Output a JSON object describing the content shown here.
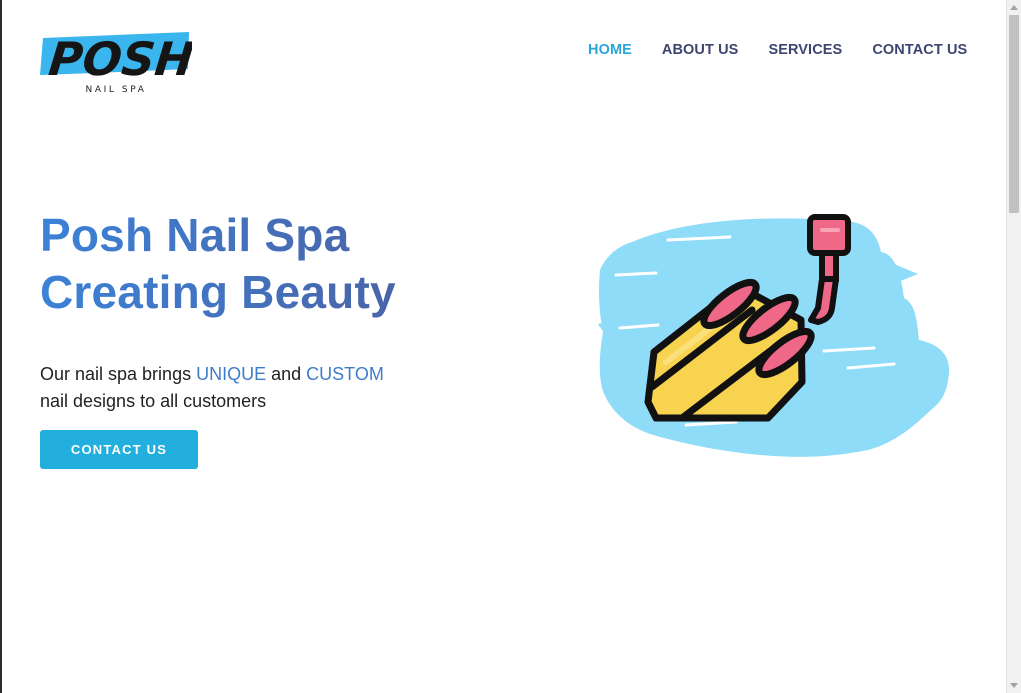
{
  "brand": {
    "logo_word": "POSH",
    "logo_tagline": "NAIL SPA",
    "accent_blue": "#26a6db",
    "logo_swatch": "#3bb5ee"
  },
  "nav": {
    "items": [
      {
        "label": "HOME",
        "active": true
      },
      {
        "label": "ABOUT US",
        "active": false
      },
      {
        "label": "SERVICES",
        "active": false
      },
      {
        "label": "CONTACT US",
        "active": false
      }
    ]
  },
  "hero": {
    "title_line1": "Posh Nail Spa",
    "title_line2": "Creating Beauty",
    "text_part1": "Our nail spa brings ",
    "highlight1": "UNIQUE",
    "text_part2": " and ",
    "highlight2": "CUSTOM",
    "text_part3": "nail designs to all customers",
    "cta_label": "CONTACT US",
    "illustration_icon": "nail-polish-hand-icon"
  }
}
